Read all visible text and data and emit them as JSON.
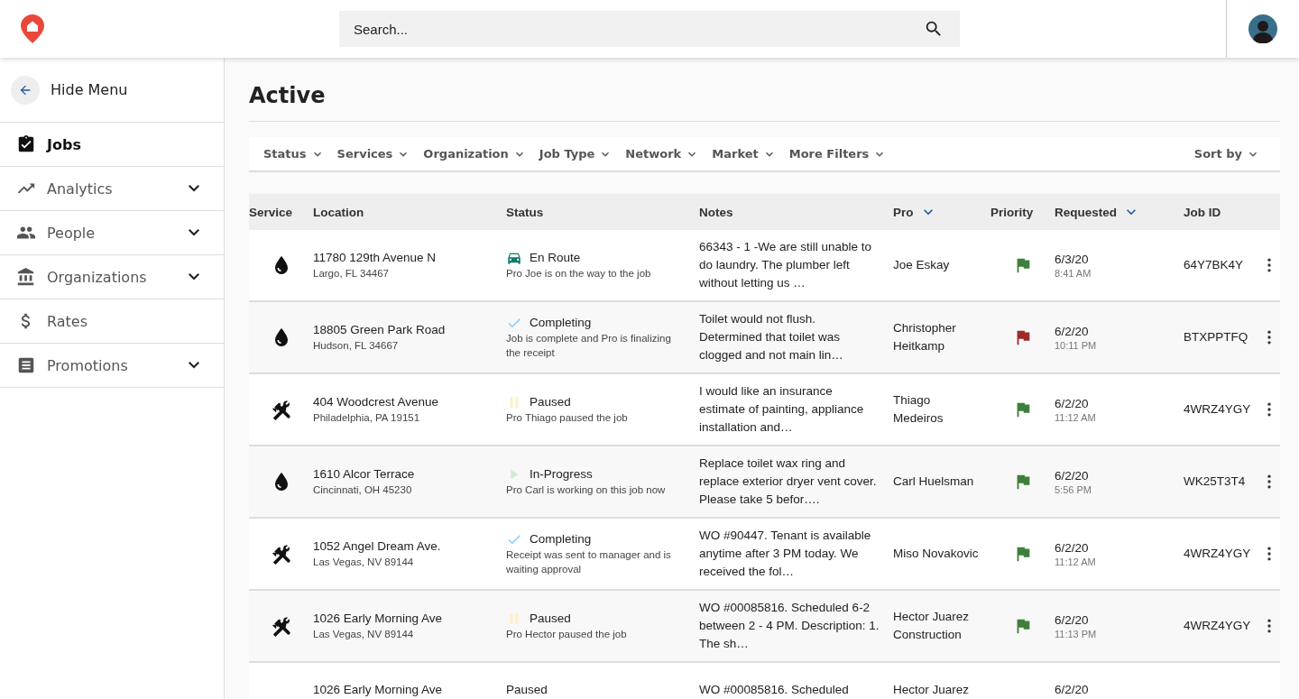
{
  "header": {
    "search": {
      "placeholder": "Search..."
    }
  },
  "sidebar": {
    "hide_menu": "Hide Menu",
    "items": [
      {
        "label": "Jobs",
        "kind": "clipboard",
        "expandable": false,
        "selected": true
      },
      {
        "label": "Analytics",
        "kind": "trend",
        "expandable": true,
        "selected": false
      },
      {
        "label": "People",
        "kind": "people",
        "expandable": true,
        "selected": false
      },
      {
        "label": "Organizations",
        "kind": "bank",
        "expandable": true,
        "selected": false
      },
      {
        "label": "Rates",
        "kind": "dollar",
        "expandable": false,
        "selected": false
      },
      {
        "label": "Promotions",
        "kind": "news",
        "expandable": true,
        "selected": false
      }
    ]
  },
  "page": {
    "title": "Active"
  },
  "filters": [
    "Status",
    "Services",
    "Organization",
    "Job Type",
    "Network",
    "Market",
    "More Filters"
  ],
  "sort": {
    "label": "Sort by"
  },
  "table": {
    "columns": [
      {
        "label": "Service",
        "sorted": false
      },
      {
        "label": "Location",
        "sorted": false
      },
      {
        "label": "Status",
        "sorted": false
      },
      {
        "label": "Notes",
        "sorted": false
      },
      {
        "label": "Pro",
        "sorted": true
      },
      {
        "label": "Priority",
        "sorted": false
      },
      {
        "label": "Requested",
        "sorted": true
      },
      {
        "label": "Job ID",
        "sorted": false
      }
    ],
    "rows": [
      {
        "kind": "water",
        "address": "11780 129th Avenue N",
        "city": "Largo, FL 34467",
        "status": {
          "kind": "en_route",
          "label": "En Route",
          "detail": "Pro Joe is on the way to the job"
        },
        "notes": "66343 - 1 -We are still unable to do laundry. The plumber left without letting us …",
        "pro": "Joe Eskay",
        "priority": {
          "color": "#3f7f3b"
        },
        "date": "6/3/20",
        "time": "8:41 AM",
        "job_id": "64Y7BK4Y"
      },
      {
        "kind": "water",
        "address": "18805 Green Park Road",
        "city": "Hudson, FL 34667",
        "status": {
          "kind": "completing",
          "label": "Completing",
          "detail": "Job is complete and Pro is finalizing the receipt"
        },
        "notes": "Toilet would not flush. Determined that toilet was clogged and not main lin…",
        "pro": "Christopher Heitkamp",
        "priority": {
          "color": "#9e2a2b"
        },
        "date": "6/2/20",
        "time": "10:11 PM",
        "job_id": "BTXPPTFQ"
      },
      {
        "kind": "tools",
        "address": "404 Woodcrest Avenue",
        "city": "Philadelphia, PA 19151",
        "status": {
          "kind": "paused",
          "label": "Paused",
          "detail": "Pro Thiago paused the job"
        },
        "notes": "I would like an insurance estimate of painting, appliance installation and…",
        "pro": "Thiago Medeiros",
        "priority": {
          "color": "#3f7f3b"
        },
        "date": "6/2/20",
        "time": "11:12 AM",
        "job_id": "4WRZ4YGY"
      },
      {
        "kind": "water",
        "address": "1610 Alcor Terrace",
        "city": "Cincinnati, OH 45230",
        "status": {
          "kind": "in_progress",
          "label": "In-Progress",
          "detail": "Pro Carl is working on this job now"
        },
        "notes": "Replace toilet wax ring and replace exterior dryer vent cover. Please take 5 befor….",
        "pro": "Carl Huelsman",
        "priority": {
          "color": "#3f7f3b"
        },
        "date": "6/2/20",
        "time": "5:56 PM",
        "job_id": "WK25T3T4"
      },
      {
        "kind": "tools",
        "address": "1052 Angel Dream Ave.",
        "city": "Las Vegas, NV 89144",
        "status": {
          "kind": "completing",
          "label": "Completing",
          "detail": "Receipt was sent to manager and is waiting approval"
        },
        "notes": "WO #90447. Tenant is available anytime after 3 PM today. We received the fol…",
        "pro": "Miso Novakovic",
        "priority": {
          "color": "#3f7f3b"
        },
        "date": "6/2/20",
        "time": "11:12 AM",
        "job_id": "4WRZ4YGY"
      },
      {
        "kind": "tools",
        "address": "1026 Early Morning Ave",
        "city": "Las Vegas, NV 89144",
        "status": {
          "kind": "paused",
          "label": "Paused",
          "detail": "Pro Hector paused the job"
        },
        "notes": "WO #00085816. Scheduled 6-2 between 2 - 4 PM. Description: 1. The sh…",
        "pro": "Hector Juarez Construction",
        "priority": {
          "color": "#3f7f3b"
        },
        "date": "6/2/20",
        "time": "11:13 PM",
        "job_id": "4WRZ4YGY"
      },
      {
        "kind": "partial",
        "address": "1026 Early Morning Ave",
        "status": {
          "kind": "plain",
          "label": "Paused"
        },
        "notes": "WO #00085816. Scheduled",
        "pro": "Hector Juarez",
        "date": "6/2/20"
      }
    ]
  }
}
